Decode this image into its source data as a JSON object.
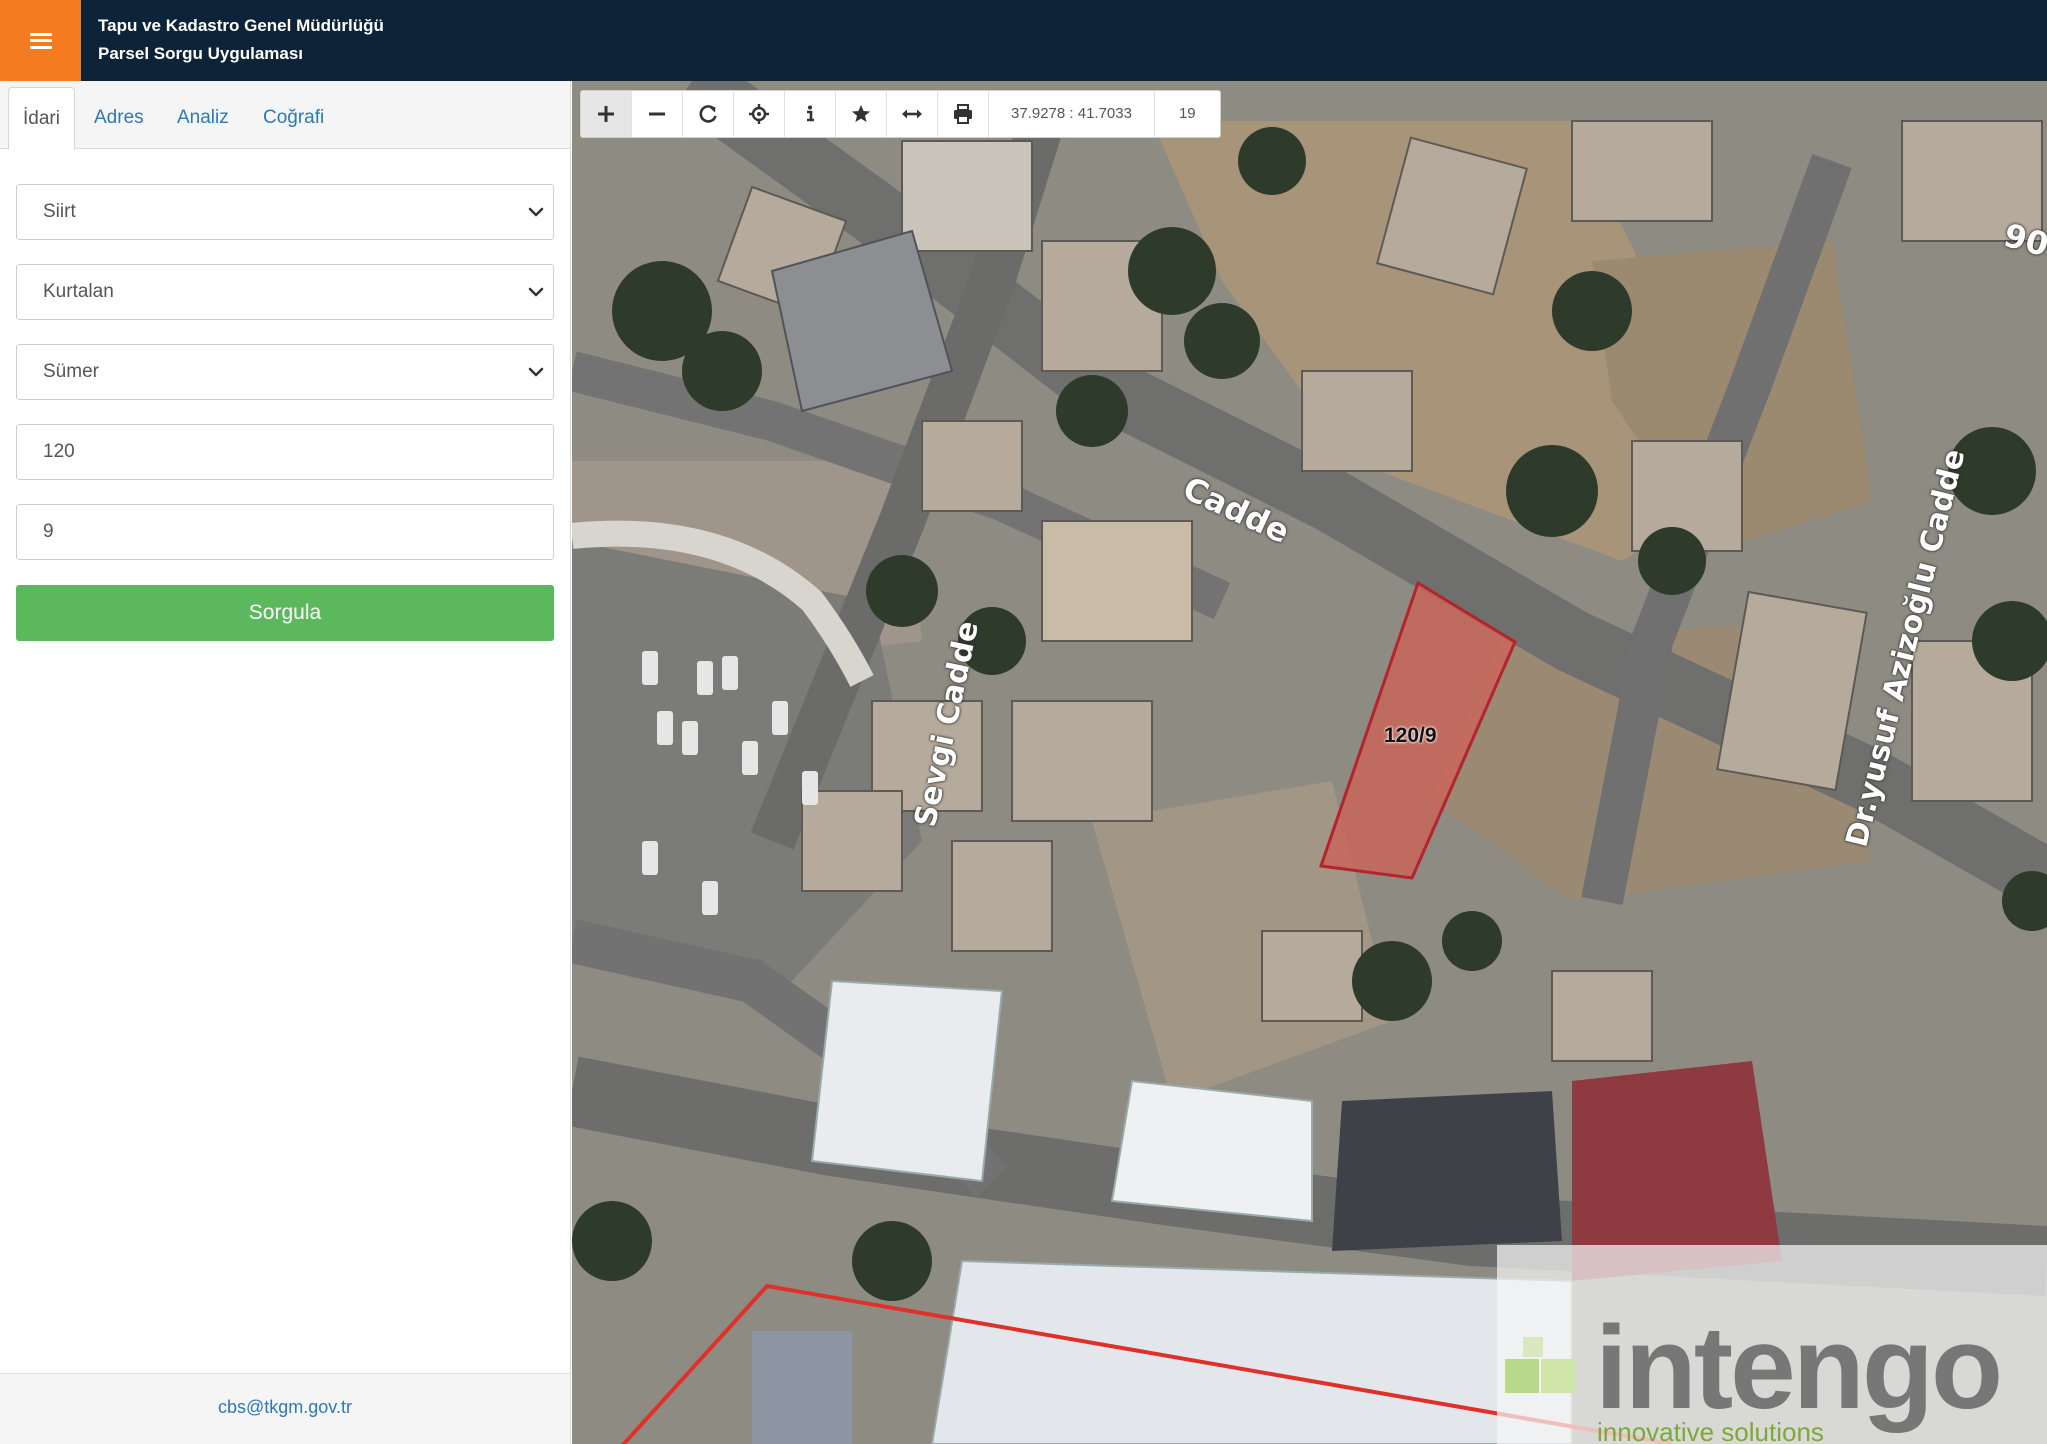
{
  "header": {
    "org_title": "Tapu ve Kadastro Genel Müdürlüğü",
    "app_title": "Parsel Sorgu Uygulaması"
  },
  "tabs": [
    {
      "label": "İdari",
      "active": true
    },
    {
      "label": "Adres",
      "active": false
    },
    {
      "label": "Analiz",
      "active": false
    },
    {
      "label": "Coğrafi",
      "active": false
    }
  ],
  "form": {
    "province": "Siirt",
    "district": "Kurtalan",
    "neighborhood": "Sümer",
    "block_no": "120",
    "parcel_no": "9",
    "submit_label": "Sorgula"
  },
  "footer": {
    "email": "cbs@tkgm.gov.tr"
  },
  "map": {
    "coordinates": "37.9278 : 41.7033",
    "zoom_level": "19",
    "parcel_label": "120/9",
    "streets": {
      "cadde_top": "Cadde",
      "sevgi": "Sevgi Cadde",
      "azizoglu": "Dr.yusuf Azizoğlu Cadde",
      "edge_number": "90"
    },
    "watermark": {
      "brand": "intengo",
      "tagline": "innovative solutions"
    },
    "colors": {
      "parcel_fill": "#c9655a",
      "parcel_stroke": "#b3242c",
      "boundary": "#e0302a"
    }
  },
  "toolbar_icons": [
    "zoom-in-icon",
    "zoom-out-icon",
    "refresh-icon",
    "locate-icon",
    "info-icon",
    "bookmark-star-icon",
    "measure-icon",
    "print-icon"
  ],
  "colors": {
    "header_bg": "#0c2338",
    "menu_accent": "#f47b20",
    "submit_green": "#5cb85c",
    "link_blue": "#2d78b8"
  }
}
